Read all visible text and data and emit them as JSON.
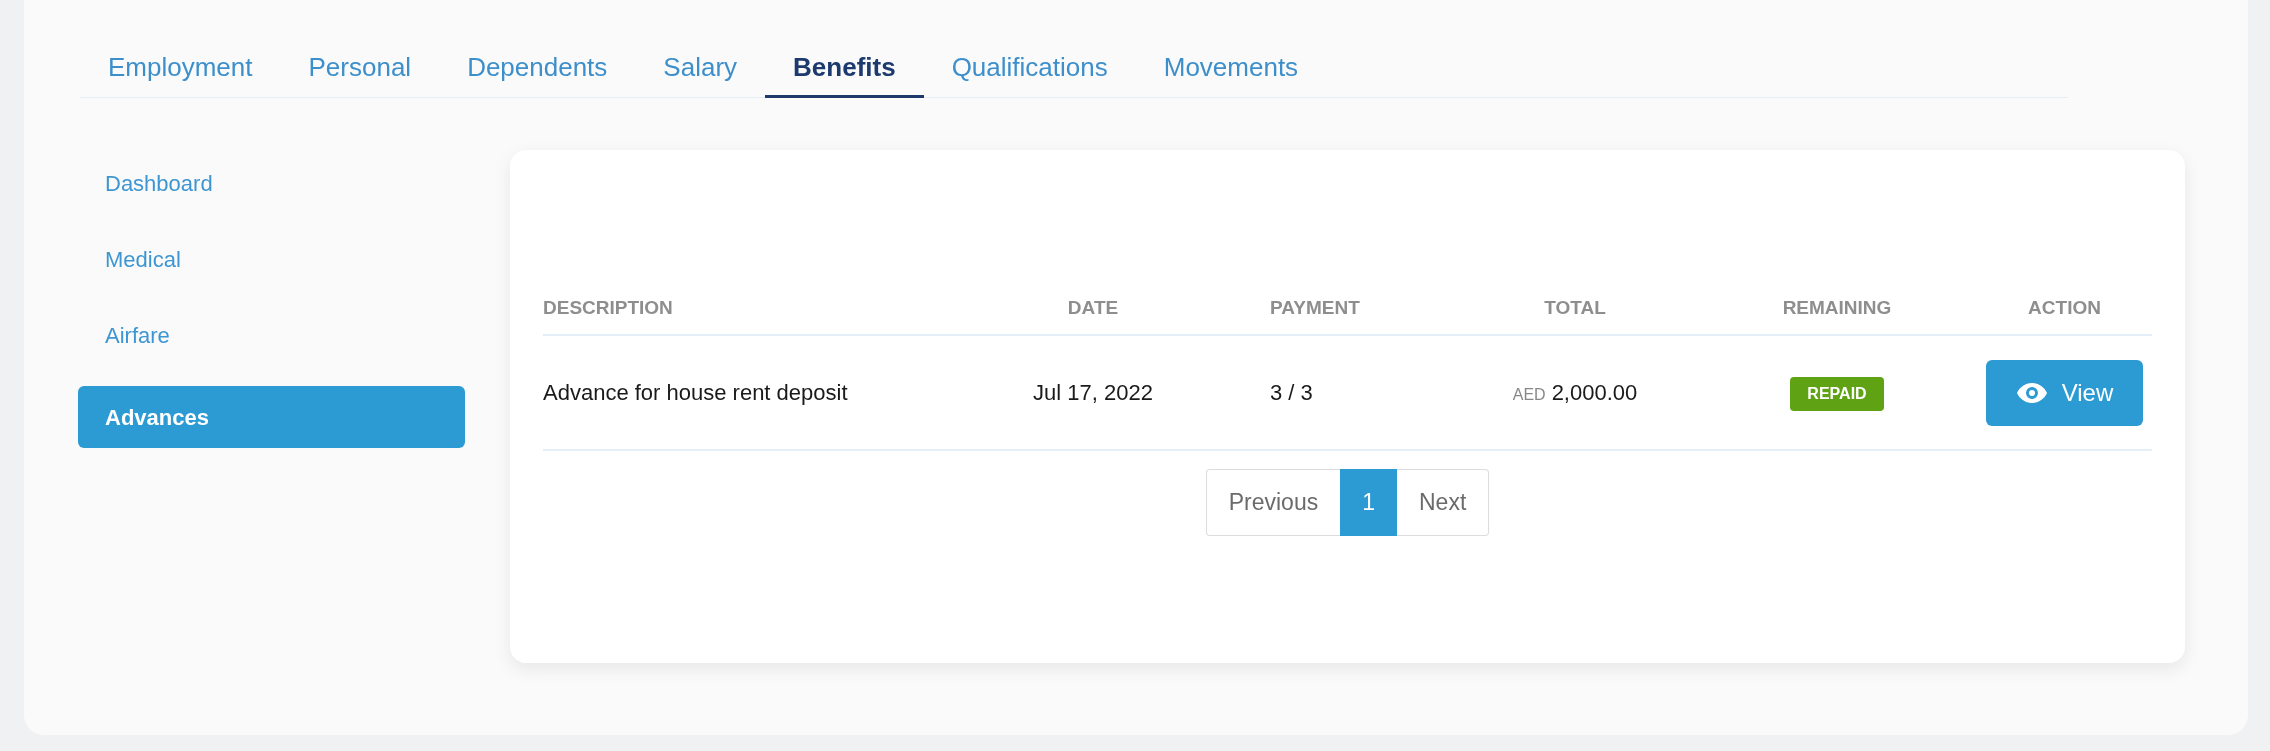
{
  "tabs": [
    {
      "label": "Employment",
      "selected": false
    },
    {
      "label": "Personal",
      "selected": false
    },
    {
      "label": "Dependents",
      "selected": false
    },
    {
      "label": "Salary",
      "selected": false
    },
    {
      "label": "Benefits",
      "selected": true
    },
    {
      "label": "Qualifications",
      "selected": false
    },
    {
      "label": "Movements",
      "selected": false
    }
  ],
  "sidebar": {
    "items": [
      {
        "label": "Dashboard",
        "selected": false
      },
      {
        "label": "Medical",
        "selected": false
      },
      {
        "label": "Airfare",
        "selected": false
      },
      {
        "label": "Advances",
        "selected": true
      }
    ]
  },
  "table": {
    "columns": [
      "DESCRIPTION",
      "DATE",
      "PAYMENT",
      "TOTAL",
      "REMAINING",
      "ACTION"
    ],
    "rows": [
      {
        "description": "Advance for house rent deposit",
        "date": "Jul 17, 2022",
        "payment": "3 / 3",
        "currency": "AED",
        "total": "2,000.00",
        "remaining": {
          "label": "REPAID",
          "color": "#5fa314"
        },
        "action": "View"
      }
    ]
  },
  "pagination": [
    {
      "label": "Previous",
      "selected": false
    },
    {
      "label": "1",
      "selected": true
    },
    {
      "label": "Next",
      "selected": false
    }
  ]
}
